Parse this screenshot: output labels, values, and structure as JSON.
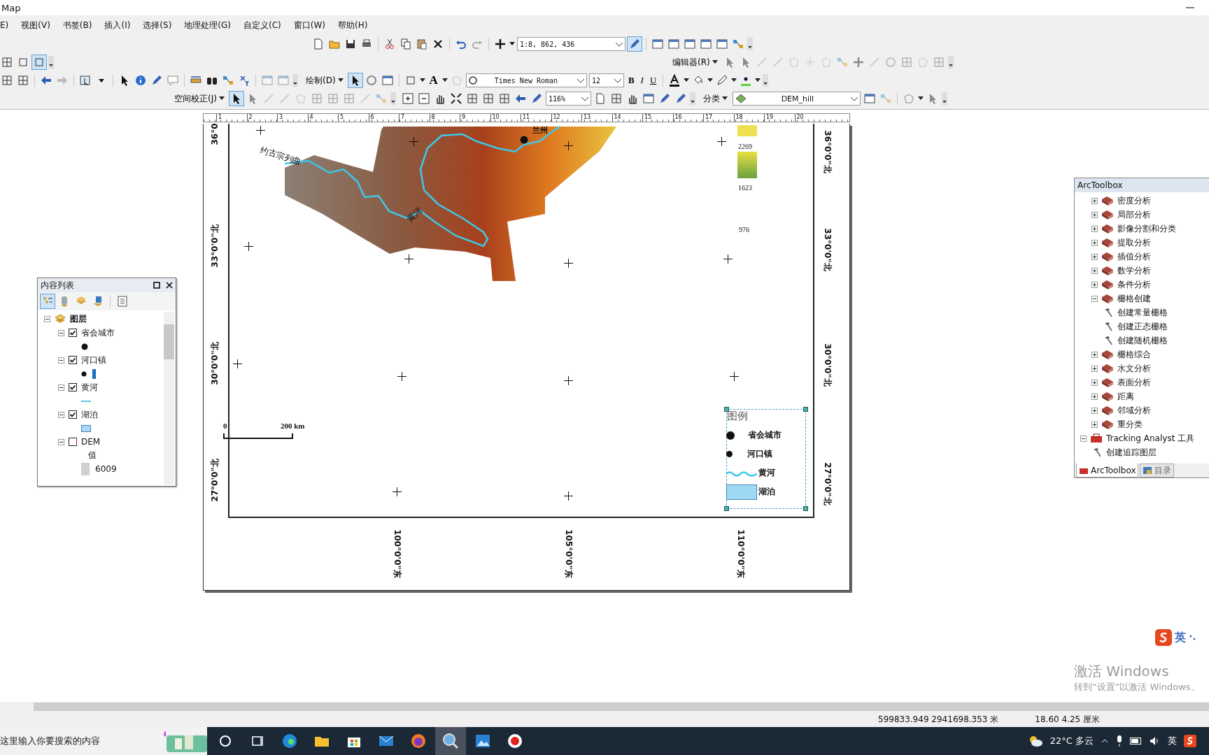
{
  "window": {
    "title": "Map"
  },
  "menu": [
    "E)",
    "视图(V)",
    "书签(B)",
    "插入(I)",
    "选择(S)",
    "地理处理(G)",
    "自定义(C)",
    "窗口(W)",
    "帮助(H)"
  ],
  "toolbars": {
    "scale": "1:8, 862, 436",
    "editor_menu": "编辑器(R)",
    "draw_menu": "绘制(D)",
    "text_tool": "A",
    "font": "Times New Roman",
    "font_size": "12",
    "bold": "B",
    "italic": "I",
    "underline": "U",
    "georef_menu": "空间校正(J)",
    "zoom": "116%",
    "classify_menu": "分类",
    "layer": "DEM_hill"
  },
  "ruler": [
    "1",
    "2",
    "3",
    "4",
    "5",
    "6",
    "7",
    "8",
    "9",
    "10",
    "11",
    "12",
    "13",
    "14",
    "15",
    "16",
    "17",
    "18",
    "19",
    "20"
  ],
  "map": {
    "lat_left": [
      "36°0",
      "33°0'0\"北",
      "30°0'0\"北",
      "27°0'0\"北"
    ],
    "lat_right": [
      "36°0'0\"北",
      "33°0'0\"北",
      "30°0'0\"北",
      "27°0'0\"北"
    ],
    "lon": [
      "100°0'0\"东",
      "105°0'0\"东",
      "110°0'0\"东"
    ],
    "city_label": "兰州",
    "river_labels": [
      "约古宗列曲",
      "黄河"
    ],
    "ramp_values": [
      "2269",
      "1623",
      "976"
    ],
    "scale_bar": {
      "start": "0",
      "end": "200 km"
    },
    "legend": {
      "title": "图例",
      "items": [
        {
          "label": "省会城市",
          "kind": "city"
        },
        {
          "label": "河口镇",
          "kind": "town"
        },
        {
          "label": "黄河",
          "kind": "river"
        },
        {
          "label": "湖泊",
          "kind": "lake"
        }
      ]
    }
  },
  "toc": {
    "title": "内容列表",
    "root": "图层",
    "layers": [
      {
        "name": "省会城市",
        "checked": true,
        "kind": "city"
      },
      {
        "name": "河口镇",
        "checked": true,
        "kind": "town"
      },
      {
        "name": "黄河",
        "checked": true,
        "kind": "river"
      },
      {
        "name": "湖泊",
        "checked": true,
        "kind": "lake"
      },
      {
        "name": "DEM",
        "checked": false,
        "kind": "raster",
        "heading": "值",
        "value": "6009"
      }
    ]
  },
  "toolbox": {
    "title": "ArcToolbox",
    "items": [
      {
        "name": "密度分析",
        "kind": "toolset",
        "expanded": false
      },
      {
        "name": "局部分析",
        "kind": "toolset",
        "expanded": false
      },
      {
        "name": "影像分割和分类",
        "kind": "toolset",
        "expanded": false
      },
      {
        "name": "提取分析",
        "kind": "toolset",
        "expanded": false
      },
      {
        "name": "插值分析",
        "kind": "toolset",
        "expanded": false
      },
      {
        "name": "数学分析",
        "kind": "toolset",
        "expanded": false
      },
      {
        "name": "条件分析",
        "kind": "toolset",
        "expanded": false
      },
      {
        "name": "栅格创建",
        "kind": "toolset",
        "expanded": true,
        "children": [
          {
            "name": "创建常量栅格",
            "kind": "tool"
          },
          {
            "name": "创建正态栅格",
            "kind": "tool"
          },
          {
            "name": "创建随机栅格",
            "kind": "tool"
          }
        ]
      },
      {
        "name": "栅格综合",
        "kind": "toolset",
        "expanded": false
      },
      {
        "name": "水文分析",
        "kind": "toolset",
        "expanded": false
      },
      {
        "name": "表面分析",
        "kind": "toolset",
        "expanded": false
      },
      {
        "name": "距离",
        "kind": "toolset",
        "expanded": false
      },
      {
        "name": "邻域分析",
        "kind": "toolset",
        "expanded": false
      },
      {
        "name": "重分类",
        "kind": "toolset",
        "expanded": false
      },
      {
        "name": "Tracking Analyst 工具",
        "kind": "toolbox",
        "expanded": true,
        "children": [
          {
            "name": "创建追踪图层",
            "kind": "tool"
          }
        ]
      }
    ],
    "tabs": [
      {
        "label": "ArcToolbox",
        "selected": true
      },
      {
        "label": "目录",
        "selected": false
      }
    ]
  },
  "status": {
    "coords": "599833.949  2941698.353 米",
    "page": "18.60  4.25 厘米"
  },
  "activation": {
    "title": "激活 Windows",
    "subtitle": "转到“设置”以激活 Windows。"
  },
  "ime": {
    "label": "英"
  },
  "taskbar": {
    "search": "这里输入你要搜索的内容",
    "weather": "22°C  多云",
    "ime": "英"
  }
}
